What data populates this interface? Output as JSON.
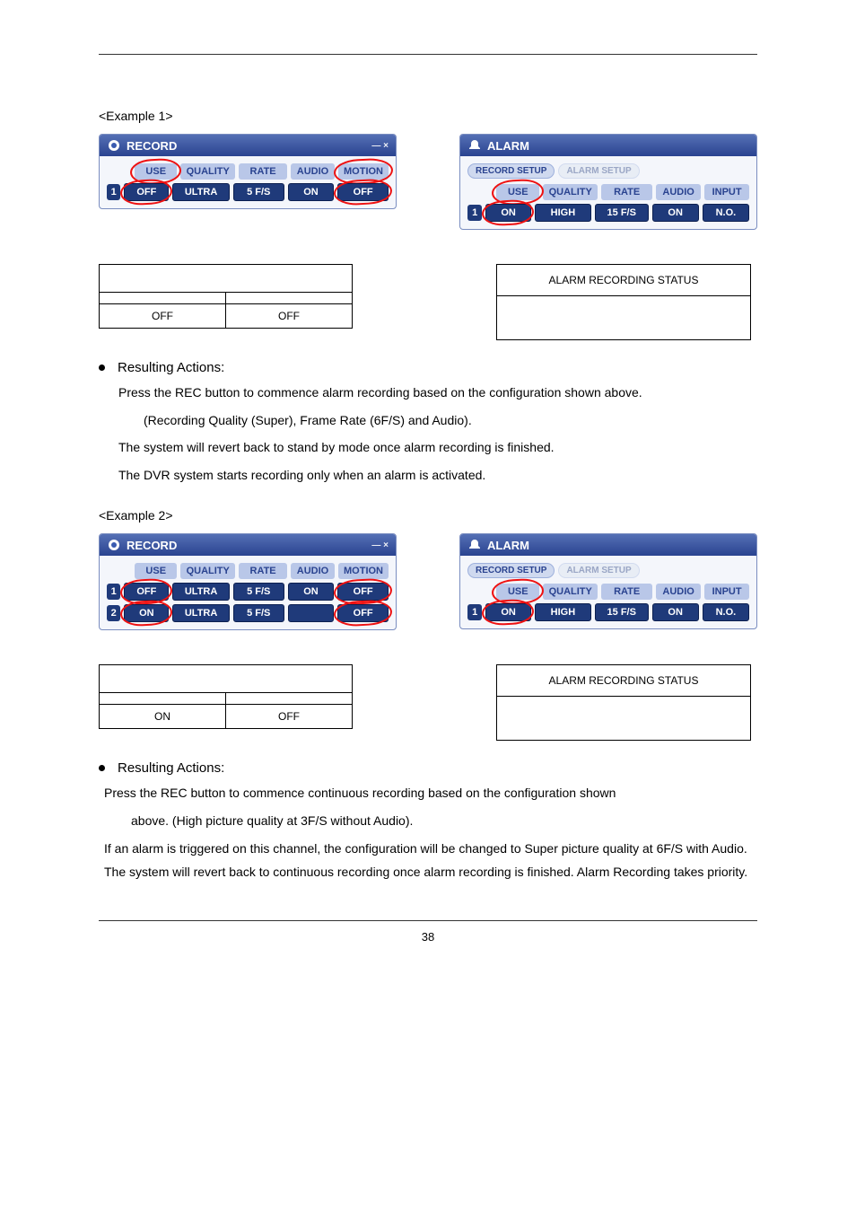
{
  "page_number": "38",
  "example1_label": "<Example 1>",
  "example2_label": "<Example 2>",
  "record_panel": {
    "title": "RECORD",
    "headers": [
      "USE",
      "QUALITY",
      "RATE",
      "AUDIO",
      "MOTION"
    ],
    "row1": {
      "num": "1",
      "use": "OFF",
      "quality": "ULTRA",
      "rate": "5 F/S",
      "audio": "ON",
      "motion": "OFF"
    }
  },
  "alarm_panel": {
    "title": "ALARM",
    "tab1": "RECORD SETUP",
    "tab2": "ALARM SETUP",
    "headers": [
      "USE",
      "QUALITY",
      "RATE",
      "AUDIO",
      "INPUT"
    ],
    "row1": {
      "num": "1",
      "use": "ON",
      "quality": "HIGH",
      "rate": "15 F/S",
      "audio": "ON",
      "input": "N.O."
    }
  },
  "record_panel2": {
    "title": "RECORD",
    "headers": [
      "USE",
      "QUALITY",
      "RATE",
      "AUDIO",
      "MOTION"
    ],
    "row1": {
      "num": "1",
      "use": "OFF",
      "quality": "ULTRA",
      "rate": "5 F/S",
      "audio": "ON",
      "motion": "OFF"
    },
    "row2": {
      "num": "2",
      "use": "ON",
      "quality": "ULTRA",
      "rate": "5 F/S",
      "audio": "",
      "motion": "OFF"
    }
  },
  "alarm_panel2": {
    "title": "ALARM",
    "tab1": "RECORD SETUP",
    "tab2": "ALARM SETUP",
    "headers": [
      "USE",
      "QUALITY",
      "RATE",
      "AUDIO",
      "INPUT"
    ],
    "row1": {
      "num": "1",
      "use": "ON",
      "quality": "HIGH",
      "rate": "15 F/S",
      "audio": "ON",
      "input": "N.O."
    }
  },
  "status1_label": "ALARM RECORDING STATUS",
  "status2_label": "ALARM RECORDING STATUS",
  "table1": {
    "c1": "OFF",
    "c2": "OFF"
  },
  "table2": {
    "c1": "ON",
    "c2": "OFF"
  },
  "resulting_actions": "Resulting Actions:",
  "p1_l1": "Press the REC button to commence alarm recording based on the configuration shown above.",
  "p1_l2": "(Recording Quality (Super), Frame Rate (6F/S) and Audio).",
  "p1_l3": "The system will revert back to stand by mode once alarm recording is finished.",
  "p1_l4": "The DVR system starts recording only when an alarm is activated.",
  "p2_l1": "Press the REC button to commence continuous recording based on the configuration shown",
  "p2_l2": "above.   (High picture quality at 3F/S without Audio).",
  "p2_l3": "If an alarm is triggered on this channel, the configuration will be changed to Super picture quality at 6F/S with Audio. The system will revert back to continuous recording once alarm recording is finished.   Alarm Recording takes priority."
}
